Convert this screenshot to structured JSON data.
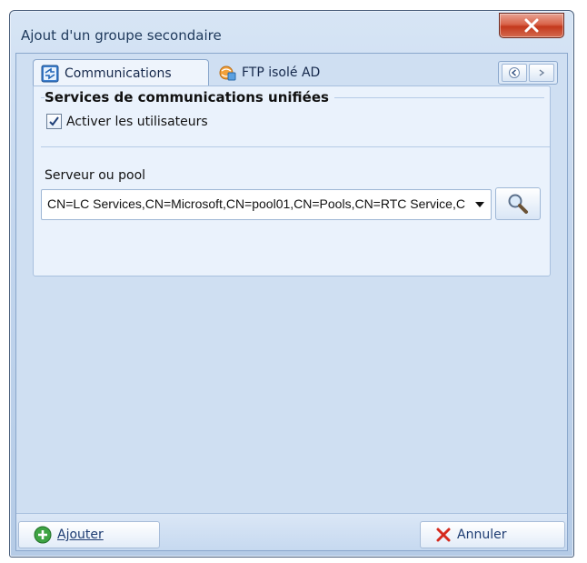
{
  "window": {
    "title": "Ajout d'un groupe secondaire"
  },
  "tabs": [
    {
      "label": "Communications",
      "icon": "communications-icon",
      "active": true
    },
    {
      "label": "FTP isolé AD",
      "icon": "ftp-icon",
      "active": false
    }
  ],
  "section": {
    "title": "Services de communications unifiées",
    "checkbox_label": "Activer les utilisateurs",
    "checkbox_checked": true
  },
  "field": {
    "label": "Serveur ou pool",
    "value": "CN=LC Services,CN=Microsoft,CN=pool01,CN=Pools,CN=RTC Service,CN=Services"
  },
  "footer": {
    "add_label": "Ajouter",
    "cancel_label": "Annuler"
  },
  "colors": {
    "accent": "#1d3c72",
    "close": "#c4391d"
  }
}
